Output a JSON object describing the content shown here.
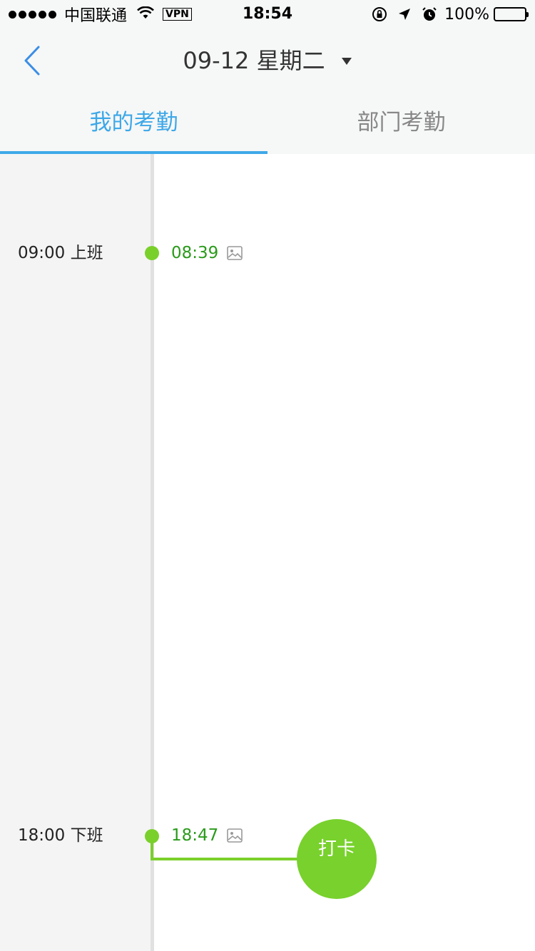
{
  "status_bar": {
    "carrier": "中国联通",
    "vpn": "VPN",
    "time": "18:54",
    "battery": "100%",
    "icons": [
      "signal-dots-icon",
      "wifi-icon",
      "lock-rotation-icon",
      "location-arrow-icon",
      "alarm-icon",
      "battery-icon"
    ]
  },
  "header": {
    "title": "09-12 星期二",
    "back_icon": "chevron-left-icon",
    "dropdown_icon": "caret-down-icon"
  },
  "tabs": [
    {
      "label": "我的考勤",
      "active": true
    },
    {
      "label": "部门考勤",
      "active": false
    }
  ],
  "schedule": [
    {
      "label": "09:00 上班",
      "punch_time": "08:39",
      "icon": "image-icon"
    },
    {
      "label": "18:00 下班",
      "punch_time": "18:47",
      "icon": "image-icon"
    }
  ],
  "clock_in_button": {
    "label": "打卡"
  },
  "colors": {
    "accent": "#3ea8e8",
    "success_green": "#7ad02b",
    "punch_text": "#2a9a1a",
    "header_bg": "#f6f7f7",
    "left_col_bg": "#f4f4f4"
  }
}
